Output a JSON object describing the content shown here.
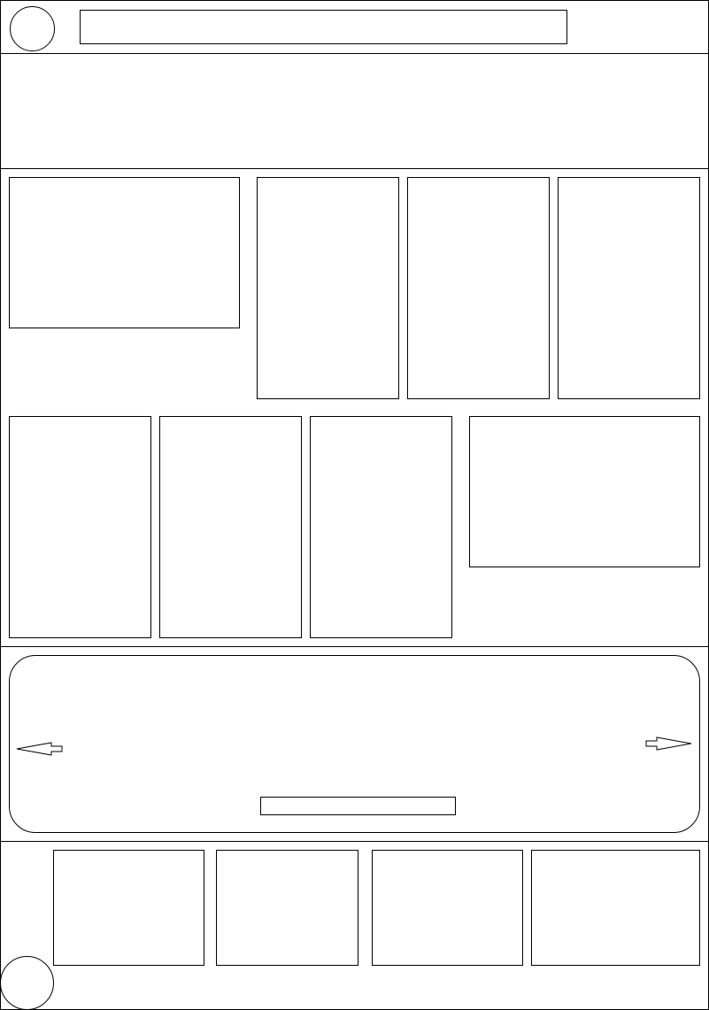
{
  "wireframe": {
    "header": {
      "logo": "",
      "search_bar": ""
    },
    "hero": {
      "content": ""
    },
    "product_grid_row_1": [
      "",
      "",
      "",
      ""
    ],
    "product_grid_row_2": [
      "",
      "",
      "",
      ""
    ],
    "carousel": {
      "prev_arrow_icon": "arrow-left-icon",
      "next_arrow_icon": "arrow-right-icon",
      "caption": ""
    },
    "footer": {
      "cards": [
        "",
        "",
        "",
        ""
      ],
      "corner_icon": ""
    },
    "colors": {
      "stroke": "#000000",
      "background": "#ffffff"
    }
  }
}
